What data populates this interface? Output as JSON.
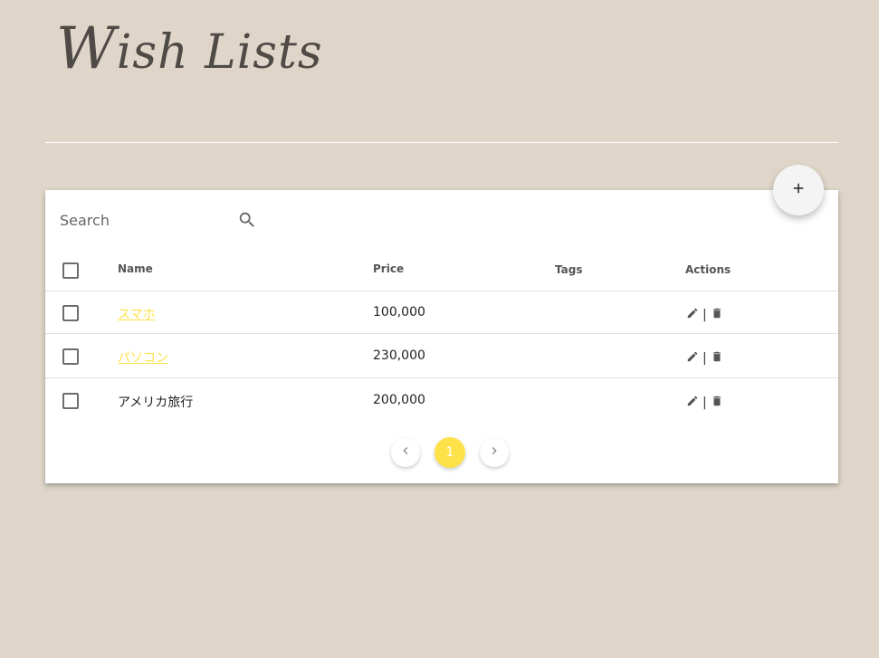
{
  "header": {
    "title_first": "W",
    "title_rest": "ish Lists"
  },
  "search": {
    "placeholder": "Search"
  },
  "table": {
    "columns": {
      "name": "Name",
      "price": "Price",
      "tags": "Tags",
      "actions": "Actions"
    },
    "rows": [
      {
        "name": "スマホ",
        "price": "100,000",
        "tags": "",
        "is_link": true
      },
      {
        "name": "パソコン",
        "price": "230,000",
        "tags": "",
        "is_link": true
      },
      {
        "name": "アメリカ旅行",
        "price": "200,000",
        "tags": "",
        "is_link": false
      }
    ],
    "action_separator": "|"
  },
  "pagination": {
    "current_page": "1"
  },
  "colors": {
    "background": "#dfd6c9",
    "accent": "#ffe24a",
    "card": "#ffffff"
  },
  "icons": {
    "add": "plus-icon",
    "search": "search-icon",
    "edit": "pencil-icon",
    "delete": "trash-icon",
    "prev": "chevron-left-icon",
    "next": "chevron-right-icon"
  }
}
